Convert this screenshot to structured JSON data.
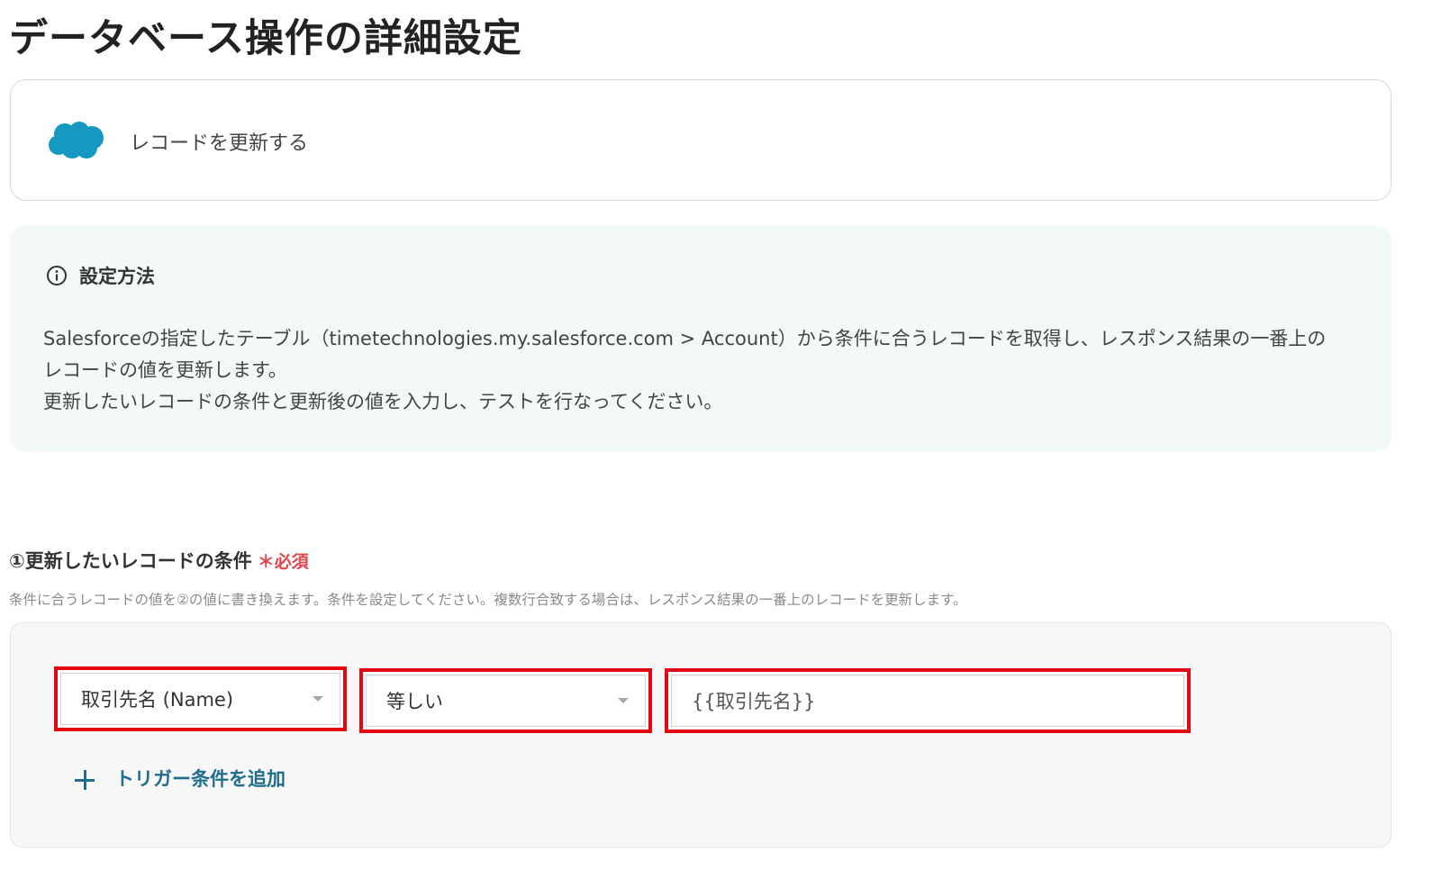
{
  "page": {
    "title": "データベース操作の詳細設定"
  },
  "app": {
    "icon": "salesforce-cloud-logo",
    "brand_color": "#1798c1",
    "action_label": "レコードを更新する"
  },
  "info": {
    "icon": "info-circle-icon",
    "heading": "設定方法",
    "lines": [
      "Salesforceの指定したテーブル（timetechnologies.my.salesforce.com > Account）から条件に合うレコードを取得し、レスポンス結果の一番上の",
      "レコードの値を更新します。",
      "更新したいレコードの条件と更新後の値を入力し、テストを行なってください。"
    ],
    "background_color": "#f3f9f9"
  },
  "condition_section": {
    "title": "①更新したいレコードの条件",
    "required_label": "＊必須",
    "description": "条件に合うレコードの値を②の値に書き換えます。条件を設定してください。複数行合致する場合は、レスポンス結果の一番上のレコードを更新します。",
    "field_select": "取引先名 (Name)",
    "operator_select": "等しい",
    "value_input": "{{取引先名}}",
    "add_condition_label": "トリガー条件を追加",
    "highlight_color": "#e30613",
    "link_color": "#1f6e8c"
  }
}
